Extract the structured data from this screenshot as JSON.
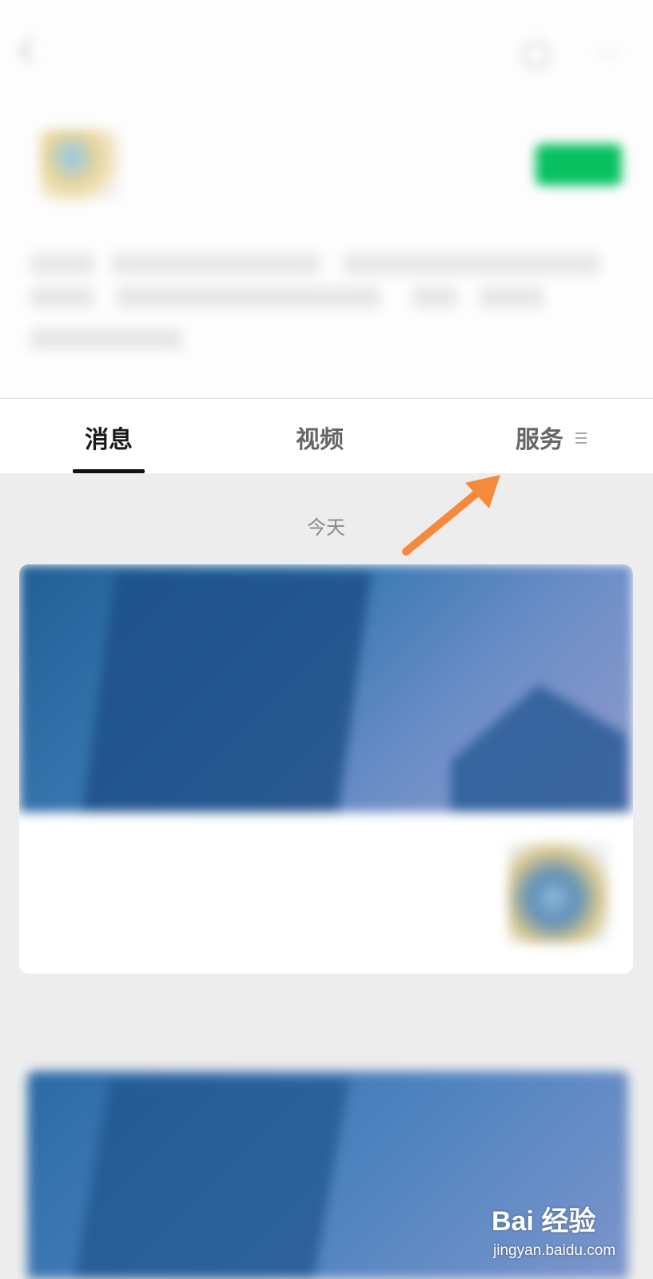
{
  "navbar": {
    "title": "",
    "back_icon": "chevron-left-icon",
    "search_icon": "search-icon",
    "more_icon": "more-icon"
  },
  "profile": {
    "account_name": "",
    "follow_label": "",
    "follow_color": "#07c160"
  },
  "tabs": {
    "items": [
      {
        "label": "消息",
        "active": true
      },
      {
        "label": "视频",
        "active": false
      },
      {
        "label": "服务",
        "active": false
      }
    ],
    "menu_icon": "menu-icon"
  },
  "feed": {
    "date_today": "今天",
    "date_second": "",
    "card": {
      "banner_big_text": "",
      "banner_sub_text": "",
      "item_text": ""
    },
    "card2": {
      "banner_big_text": ""
    }
  },
  "annotation": {
    "arrow_color": "#f48a3a"
  },
  "watermark": {
    "logo": "Bai 经验",
    "url": "jingyan.baidu.com"
  }
}
